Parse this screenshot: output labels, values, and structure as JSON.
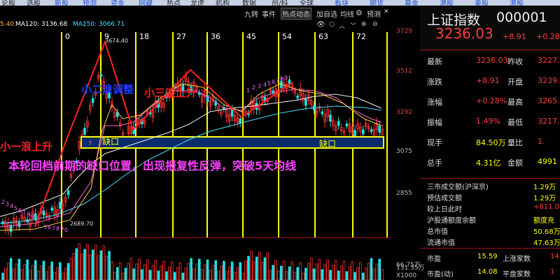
{
  "top_menu": {
    "left_items": [
      "论股",
      "选股",
      "新股",
      "预测",
      "资金",
      "网藏",
      "热点",
      "龙虎",
      "机构",
      "数据",
      "创/科",
      "全球"
    ],
    "right_items": [
      "板块",
      "期货",
      "基金",
      "港股",
      "美股",
      "港股"
    ]
  },
  "toolbar": {
    "date_fragment": "5.40",
    "items": [
      "九转",
      "事件",
      "热点动态",
      "加自选",
      "均线",
      "预测"
    ],
    "selected": "热点动态",
    "settings_icon": "gear-icon"
  },
  "ma_legend": {
    "ma120_label": "MA120: 3136.68",
    "ma250_label": "MA250: 3066.71",
    "ma120_color": "#ffffff",
    "ma250_color": "#40e0ff"
  },
  "chart": {
    "axis_ticks": [
      "3729",
      "3512",
      "3292",
      "3075",
      "2855"
    ],
    "vol_axis": [
      "131.35万",
      "66.75万",
      "X1000"
    ],
    "high_label": "3674.40",
    "low_label": "2689.70",
    "nine_turn_labels": [
      "0",
      "9",
      "18",
      "27",
      "36",
      "45",
      "54",
      "63",
      "72",
      "8"
    ],
    "counts_up": [
      "1",
      "2",
      "3",
      "4",
      "5",
      "6",
      "7",
      "8",
      "9"
    ],
    "counts_left": [
      "2",
      "3",
      "4",
      "5",
      "6",
      "7",
      "8",
      "9"
    ],
    "counts_bottom": [
      "5",
      "6",
      "7",
      "8",
      "9",
      "0"
    ],
    "gap_label_1": "缺口",
    "gap_label_2": "缺口",
    "gap_box_number": "7"
  },
  "annotations": {
    "wave1": "小一浪上升",
    "wave2": "小二浪调整",
    "wave3": "小三浪上升",
    "summary": "本轮回档前期的缺口位置，出现报复性反弹，突破5天均线"
  },
  "quote_panel": {
    "name": "上证指数",
    "code": "000001",
    "price": "3236.03",
    "change": "+8.91",
    "change_pct": "+0.28%",
    "rows": [
      {
        "l1": "最新",
        "v1": "3236.03",
        "l2": "昨收",
        "v2": "3227."
      },
      {
        "l1": "涨跌",
        "v1": "+8.91",
        "l2": "开盘",
        "v2": "3239."
      },
      {
        "l1": "涨幅",
        "v1": "+0.28%",
        "l2": "最高",
        "v2": "3265."
      },
      {
        "l1": "振幅",
        "v1": "1.49%",
        "l2": "最低",
        "v2": "3217."
      },
      {
        "l1": "现手",
        "v1": "84.50万",
        "l2": "量比",
        "v2": "1."
      },
      {
        "l1": "总手",
        "v1": "4.31亿",
        "l2": "金额",
        "v2": "4991"
      }
    ],
    "stats": [
      {
        "l": "三市成交额(沪深京)",
        "v": "1.29万"
      },
      {
        "l": "预估成交额",
        "v": "1.29万"
      },
      {
        "l": "较上日此时",
        "v": "+811.0"
      },
      {
        "l": "沪股通额度余额",
        "v": "额度充"
      },
      {
        "l": "总市值",
        "v": "50.68万"
      },
      {
        "l": "流通市值",
        "v": "47.63万"
      }
    ],
    "bottom": [
      {
        "l1": "市盈",
        "v1": "15.59",
        "l2": "上涨家数",
        "v2": "14"
      },
      {
        "l1": "市盈(动)",
        "v1": "14.08",
        "l2": "平盘家数",
        "v2": "1"
      }
    ]
  }
}
